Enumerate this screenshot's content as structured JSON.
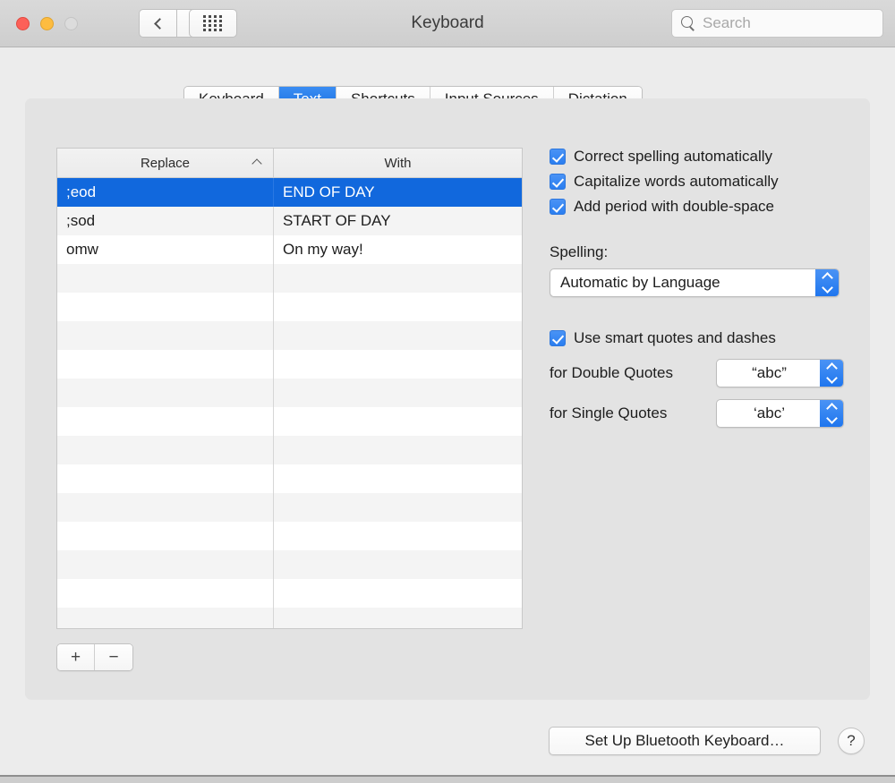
{
  "window": {
    "title": "Keyboard",
    "traffic_lights": [
      "close",
      "minimize",
      "zoom"
    ],
    "nav": {
      "back": "‹",
      "forward": "›"
    },
    "grid_button": "show-all-grid"
  },
  "search": {
    "placeholder": "Search",
    "value": ""
  },
  "tabs": [
    {
      "label": "Keyboard",
      "active": false
    },
    {
      "label": "Text",
      "active": true
    },
    {
      "label": "Shortcuts",
      "active": false
    },
    {
      "label": "Input Sources",
      "active": false
    },
    {
      "label": "Dictation",
      "active": false
    }
  ],
  "table": {
    "columns": [
      {
        "label": "Replace",
        "sort": "ascending"
      },
      {
        "label": "With",
        "sort": null
      }
    ],
    "rows": [
      {
        "replace": ";eod",
        "with": "END OF DAY",
        "selected": true
      },
      {
        "replace": ";sod",
        "with": "START OF DAY",
        "selected": false
      },
      {
        "replace": "omw",
        "with": "On my way!",
        "selected": false
      }
    ],
    "empty_row_count": 13
  },
  "table_buttons": {
    "add": "+",
    "remove": "−"
  },
  "options": {
    "checkboxes": [
      {
        "label": "Correct spelling automatically",
        "checked": true
      },
      {
        "label": "Capitalize words automatically",
        "checked": true
      },
      {
        "label": "Add period with double-space",
        "checked": true
      }
    ],
    "spelling_label": "Spelling:",
    "spelling_value": "Automatic by Language",
    "smart_quotes": {
      "label": "Use smart quotes and dashes",
      "checked": true
    },
    "double_quotes_label": "for Double Quotes",
    "double_quotes_value": "“abc”",
    "single_quotes_label": "for Single Quotes",
    "single_quotes_value": "‘abc’"
  },
  "footer": {
    "bluetooth_button": "Set Up Bluetooth Keyboard…",
    "help_button": "?"
  },
  "colors": {
    "accent_blue": "#1168dd",
    "tab_active_blue": "#1a6fe0",
    "checkbox_blue": "#2a7ef0",
    "window_bg": "#ececec",
    "panel_bg": "#e3e3e3"
  }
}
